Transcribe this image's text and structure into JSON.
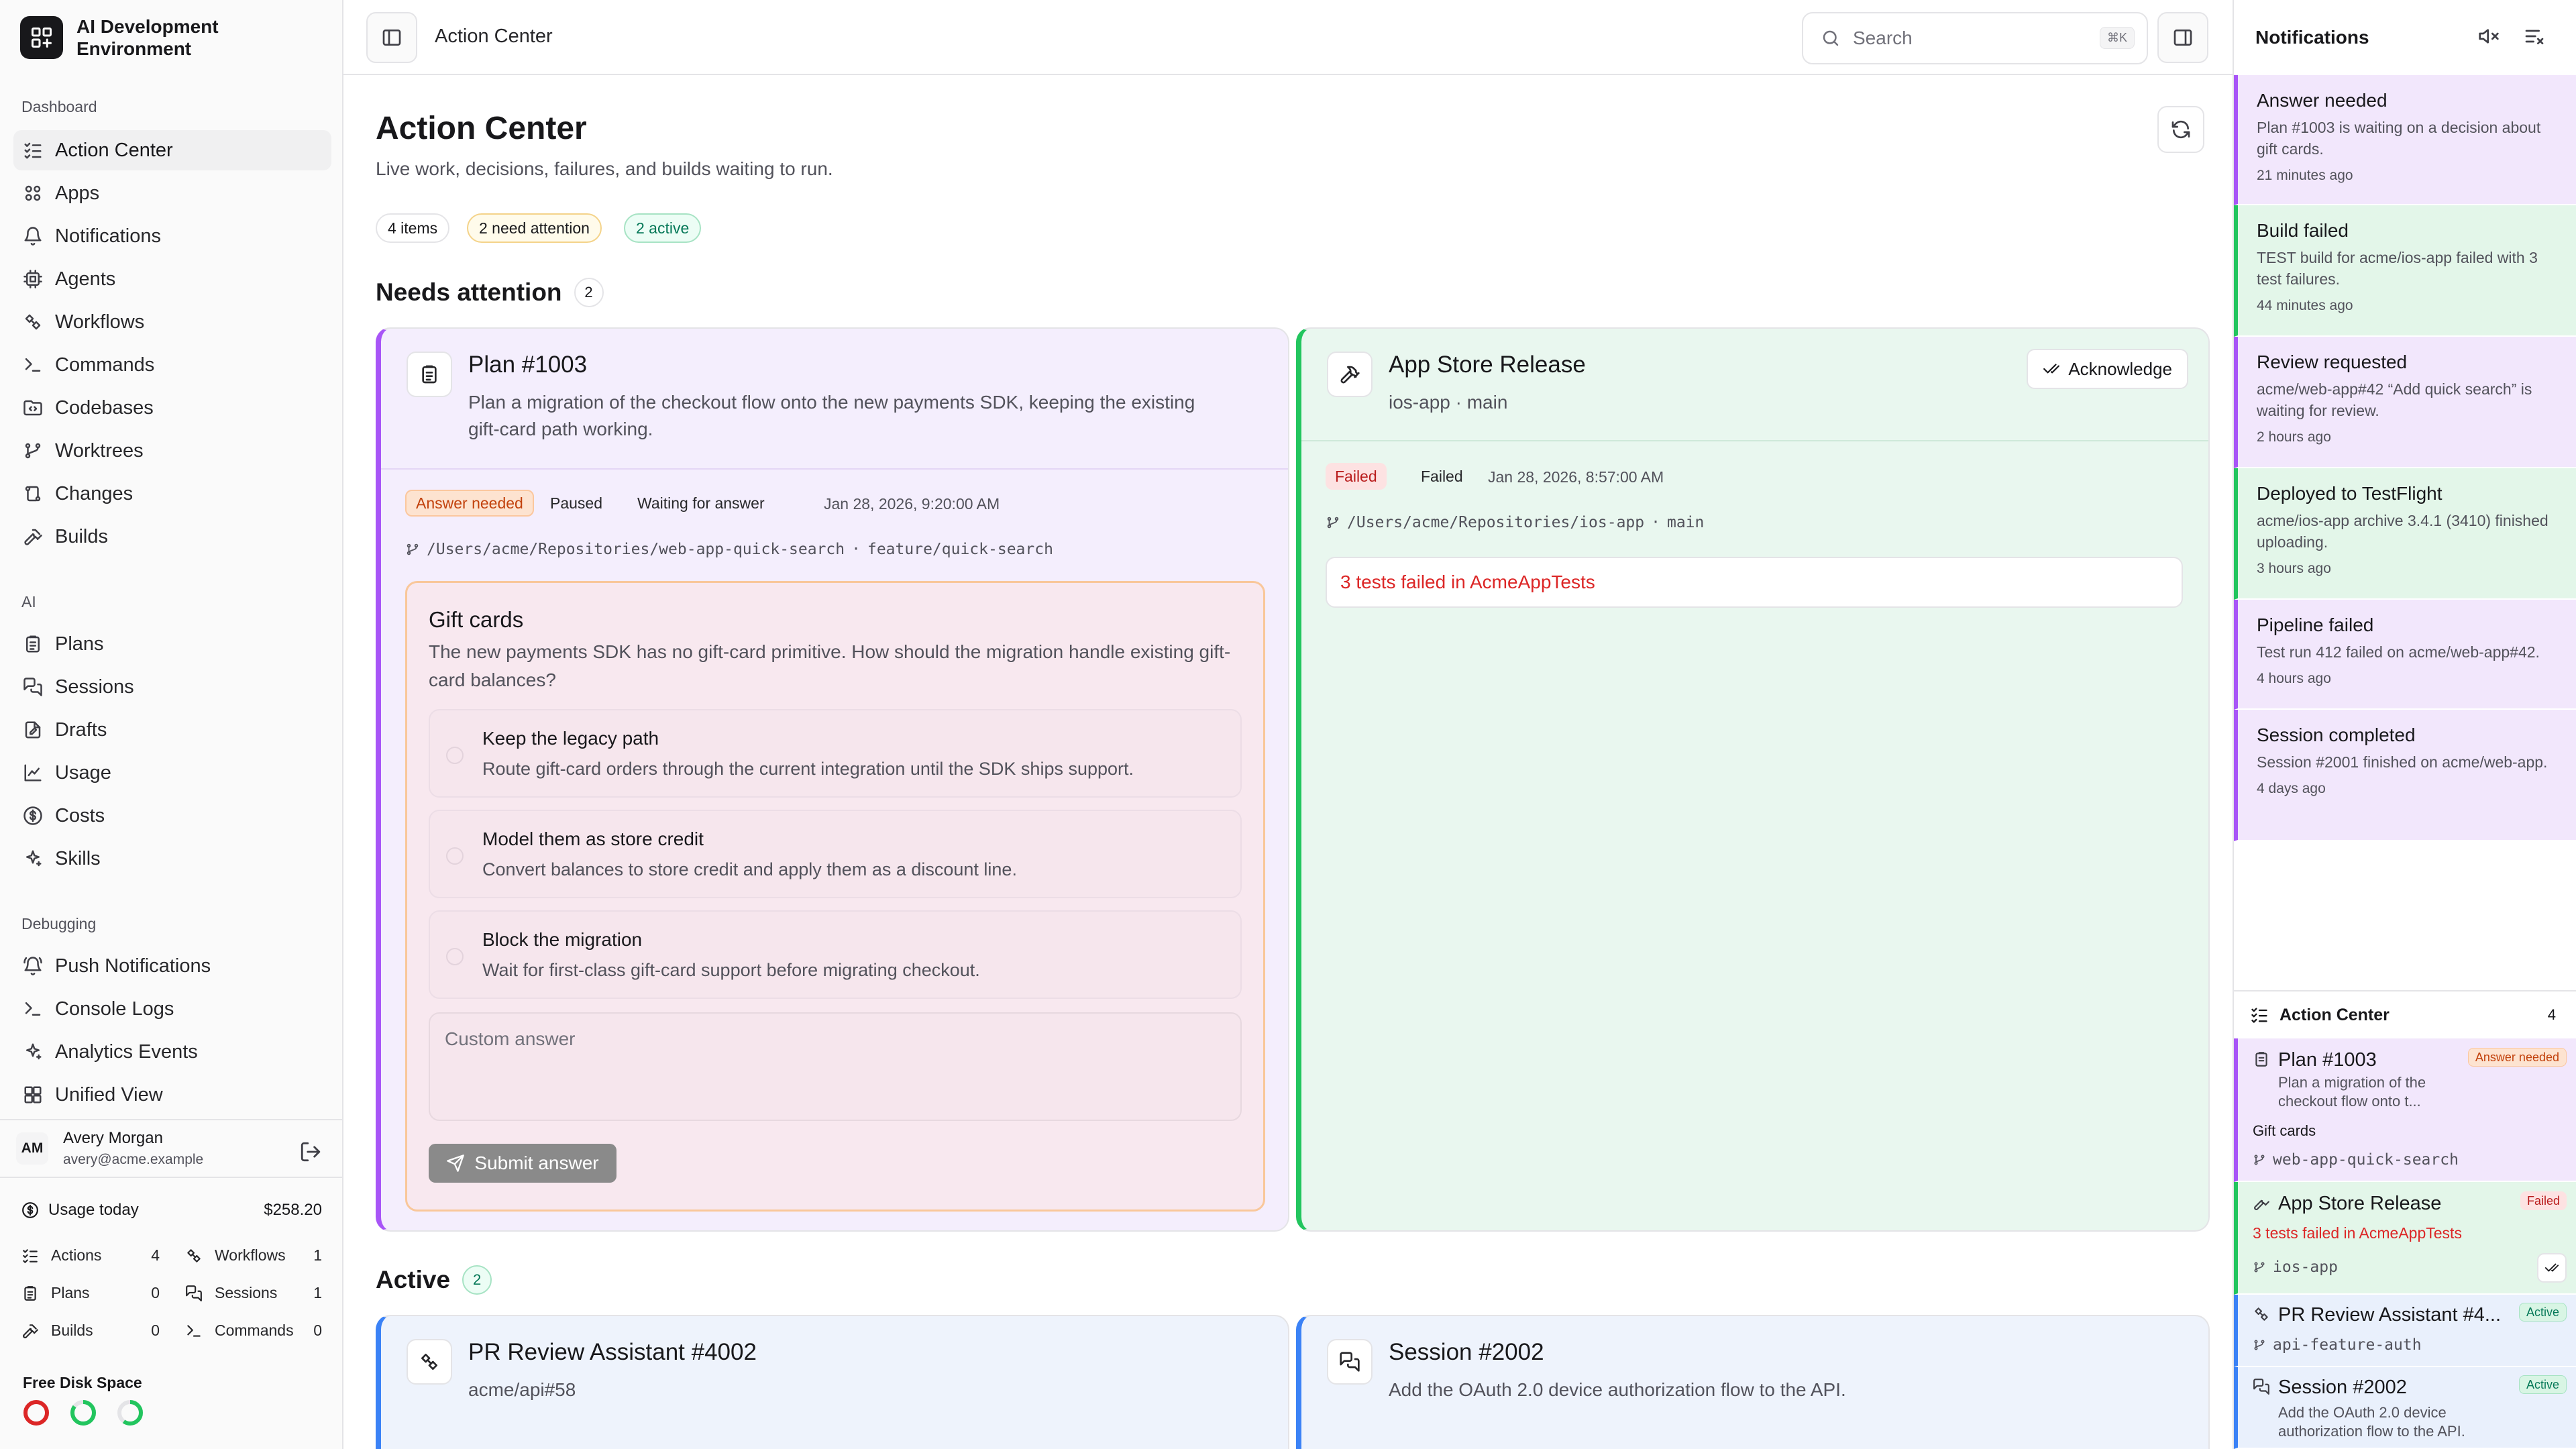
{
  "app": {
    "name": "AI Development Environment"
  },
  "sidebar": {
    "sections": {
      "dashboard": "Dashboard",
      "ai": "AI",
      "debugging": "Debugging"
    },
    "dashboard_items": [
      {
        "label": "Action Center",
        "icon": "checklist-icon"
      },
      {
        "label": "Apps",
        "icon": "apps-icon"
      },
      {
        "label": "Notifications",
        "icon": "bell-icon"
      },
      {
        "label": "Agents",
        "icon": "cpu-icon"
      },
      {
        "label": "Workflows",
        "icon": "workflow-icon"
      },
      {
        "label": "Commands",
        "icon": "terminal-icon"
      },
      {
        "label": "Codebases",
        "icon": "folder-code-icon"
      },
      {
        "label": "Worktrees",
        "icon": "branch-icon"
      },
      {
        "label": "Changes",
        "icon": "diff-icon"
      },
      {
        "label": "Builds",
        "icon": "hammer-icon"
      }
    ],
    "ai_items": [
      {
        "label": "Plans",
        "icon": "clipboard-icon"
      },
      {
        "label": "Sessions",
        "icon": "chat-icon"
      },
      {
        "label": "Drafts",
        "icon": "draft-icon"
      },
      {
        "label": "Usage",
        "icon": "chart-icon"
      },
      {
        "label": "Costs",
        "icon": "dollar-icon"
      },
      {
        "label": "Skills",
        "icon": "sparkle-icon"
      }
    ],
    "debug_items": [
      {
        "label": "Push Notifications",
        "icon": "bell-ring-icon"
      },
      {
        "label": "Console Logs",
        "icon": "terminal-icon"
      },
      {
        "label": "Analytics Events",
        "icon": "sparkle-icon"
      },
      {
        "label": "Unified View",
        "icon": "grid-icon"
      }
    ],
    "user": {
      "initials": "AM",
      "name": "Avery Morgan",
      "email": "avery@acme.example"
    },
    "usage": {
      "label": "Usage today",
      "value": "$258.20"
    },
    "stats": [
      {
        "label": "Actions",
        "value": "4"
      },
      {
        "label": "Workflows",
        "value": "1"
      },
      {
        "label": "Plans",
        "value": "0"
      },
      {
        "label": "Sessions",
        "value": "1"
      },
      {
        "label": "Builds",
        "value": "0"
      },
      {
        "label": "Commands",
        "value": "0"
      }
    ],
    "disk": {
      "label": "Free Disk Space",
      "rings": [
        {
          "color": "#dc2626",
          "fraction": 1.0
        },
        {
          "color": "#22c55e",
          "fraction": 0.85
        },
        {
          "color": "#22c55e",
          "fraction": 0.6
        }
      ]
    }
  },
  "topbar": {
    "title": "Action Center",
    "search_placeholder": "Search",
    "shortcut": "⌘K"
  },
  "main": {
    "title": "Action Center",
    "subtitle": "Live work, decisions, failures, and builds waiting to run.",
    "pills": [
      "4 items",
      "2 need attention",
      "2 active"
    ],
    "needs_attention": {
      "title": "Needs attention",
      "count": "2"
    },
    "active": {
      "title": "Active",
      "count": "2"
    },
    "plan_card": {
      "title": "Plan #1003",
      "desc_line1": "Plan a migration of the checkout flow onto the new payments SDK, keeping the existing",
      "desc_line2": "gift-card path working.",
      "badges": [
        "Answer needed",
        "Paused",
        "Waiting for answer"
      ],
      "date": "Jan 28, 2026, 9:20:00 AM",
      "path": "/Users/acme/Repositories/web-app-quick-search",
      "branch": "feature/quick-search",
      "question": {
        "title": "Gift cards",
        "text": "The new payments SDK has no gift-card primitive. How should the migration handle existing gift-card balances?",
        "options": [
          {
            "title": "Keep the legacy path",
            "desc": "Route gift-card orders through the current integration until the SDK ships support."
          },
          {
            "title": "Model them as store credit",
            "desc": "Convert balances to store credit and apply them as a discount line."
          },
          {
            "title": "Block the migration",
            "desc": "Wait for first-class gift-card support before migrating checkout."
          }
        ],
        "custom_placeholder": "Custom answer",
        "submit_label": "Submit answer"
      }
    },
    "release_card": {
      "title": "App Store Release",
      "subtitle": "ios-app · main",
      "ack_label": "Acknowledge",
      "badges": [
        "Failed",
        "Failed"
      ],
      "date": "Jan 28, 2026, 8:57:00 AM",
      "path": "/Users/acme/Repositories/ios-app",
      "branch": "main",
      "failure": "3 tests failed in AcmeAppTests"
    },
    "pr_card": {
      "title": "PR Review Assistant #4002",
      "subtitle": "acme/api#58"
    },
    "session_card": {
      "title": "Session #2002",
      "subtitle": "Add the OAuth 2.0 device authorization flow to the API."
    }
  },
  "notifications": {
    "title": "Notifications",
    "items": [
      {
        "title": "Answer needed",
        "desc": "Plan #1003 is waiting on a decision about gift cards.",
        "time": "21 minutes ago",
        "tone": "purple"
      },
      {
        "title": "Build failed",
        "desc": "TEST build for acme/ios-app failed with 3 test failures.",
        "time": "44 minutes ago",
        "tone": "green"
      },
      {
        "title": "Review requested",
        "desc": "acme/web-app#42 “Add quick search” is waiting for review.",
        "time": "2 hours ago",
        "tone": "purple"
      },
      {
        "title": "Deployed to TestFlight",
        "desc": "acme/ios-app archive 3.4.1 (3410) finished uploading.",
        "time": "3 hours ago",
        "tone": "green"
      },
      {
        "title": "Pipeline failed",
        "desc": "Test run 412 failed on acme/web-app#42.",
        "time": "4 hours ago",
        "tone": "purple"
      },
      {
        "title": "Session completed",
        "desc": "Session #2001 finished on acme/web-app.",
        "time": "4 days ago",
        "tone": "purple"
      }
    ]
  },
  "action_center_panel": {
    "title": "Action Center",
    "count": "4",
    "items": [
      {
        "title": "Plan #1003",
        "badge": "Answer needed",
        "desc": "Plan a migration of the checkout flow onto t...",
        "sub": "Gift cards",
        "path": "web-app-quick-search"
      },
      {
        "title": "App Store Release",
        "badge": "Failed",
        "desc": "3 tests failed in AcmeAppTests",
        "path": "ios-app"
      },
      {
        "title": "PR Review Assistant #4...",
        "badge": "Active",
        "path": "api-feature-auth"
      },
      {
        "title": "Session #2002",
        "badge": "Active",
        "desc": "Add the OAuth 2.0 device authorization flow to the API."
      }
    ]
  }
}
